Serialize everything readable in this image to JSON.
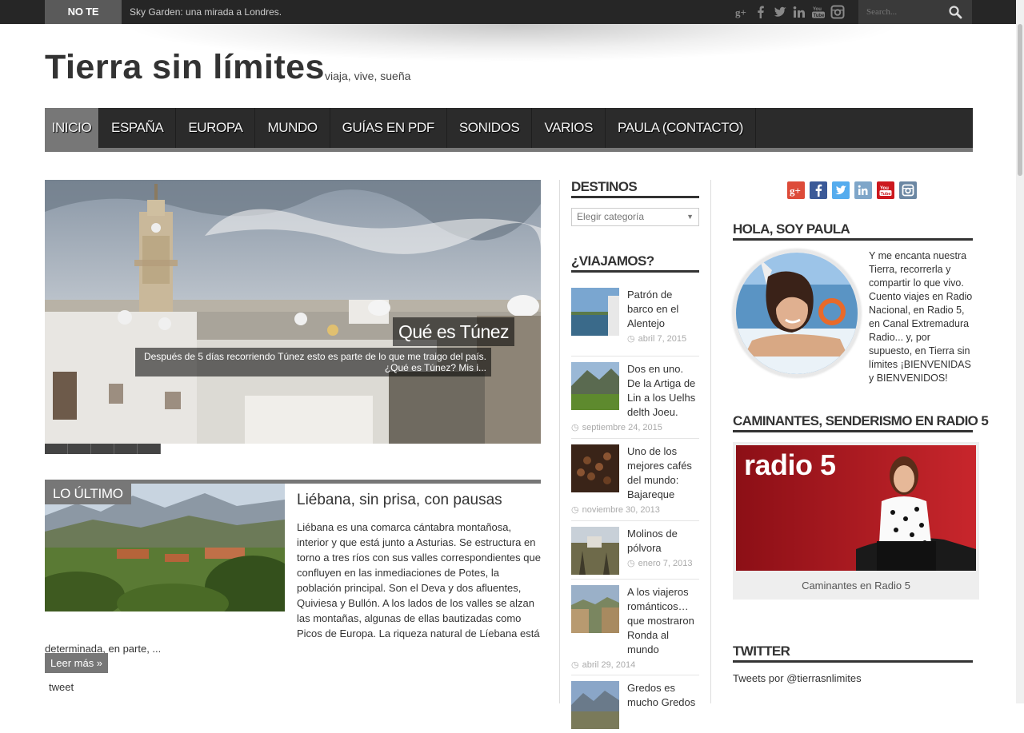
{
  "topbar": {
    "label": "NO TE PIERDAS",
    "ticker": "Sky Garden: una mirada a Londres.",
    "social_icons": [
      "google-plus-icon",
      "facebook-icon",
      "twitter-icon",
      "linkedin-icon",
      "youtube-icon",
      "instagram-icon"
    ],
    "search_placeholder": "Search..."
  },
  "header": {
    "title": "Tierra sin límites",
    "tagline": "viaja, vive, sueña"
  },
  "nav": {
    "items": [
      {
        "label": "INICIO"
      },
      {
        "label": "ESPAÑA"
      },
      {
        "label": "EUROPA"
      },
      {
        "label": "MUNDO"
      },
      {
        "label": "GUÍAS EN PDF"
      },
      {
        "label": "SONIDOS"
      },
      {
        "label": "VARIOS"
      },
      {
        "label": "PAULA (CONTACTO)"
      }
    ]
  },
  "slider": {
    "title": "Qué es Túnez",
    "excerpt": "Después de 5 días recorriendo Túnez esto es parte de lo que me traigo del país. ¿Qué es Túnez? Mis i..."
  },
  "latest": {
    "label": "LO ÚLTIMO",
    "post_title": "Liébana, sin prisa, con pausas",
    "post_body": "Liébana es una comarca cántabra montañosa, interior y que está junto a Asturias. Se estructura en torno a tres ríos con sus valles correspondientes que confluyen en las inmediaciones de Potes, la población principal. Son el Deva y dos afluentes, Quiviesa y Bullón. A los lados de los valles se alzan las montañas, algunas de ellas bautizadas como Picos de Europa. La riqueza natural de Líebana está determinada, en parte, ...",
    "read_more": "Leer más »",
    "tweet": "tweet"
  },
  "sidebar_left": {
    "destinos_title": "DESTINOS",
    "select_value": "Elegir categoría",
    "viajamos_title": "¿VIAJAMOS?",
    "posts": [
      {
        "title": "Patrón de barco en el Alentejo",
        "date": "abril 7, 2015"
      },
      {
        "title": "Dos en uno. De la Artiga de Lin a los Uelhs delth Joeu.",
        "date": "septiembre 24, 2015"
      },
      {
        "title": "Uno de los mejores cafés del mundo: Bajareque",
        "date": "noviembre 30, 2013"
      },
      {
        "title": "Molinos de pólvora",
        "date": "enero 7, 2013"
      },
      {
        "title": "A los viajeros románticos… que mostraron Ronda al mundo",
        "date": "abril 29, 2014"
      },
      {
        "title": "Gredos es mucho Gredos",
        "date": ""
      }
    ]
  },
  "sidebar_right": {
    "social_icons": [
      "google-plus-icon",
      "facebook-icon",
      "twitter-icon",
      "linkedin-icon",
      "youtube-icon",
      "instagram-icon"
    ],
    "hola_title": "HOLA, SOY PAULA",
    "hola_text": "Y me encanta nuestra Tierra, recorrerla y compartir lo que vivo. Cuento viajes en Radio Nacional, en Radio 5, en Canal Extremadura Radio... y, por supuesto, en Tierra sin límites ¡BIENVENIDAS y BIENVENIDOS!",
    "caminantes_title": "CAMINANTES, SENDERISMO EN RADIO 5",
    "radio_logo": "radio 5",
    "radio_caption": "Caminantes en Radio 5",
    "twitter_title": "TWITTER",
    "twitter_text": "Tweets por @tierrasnlimites"
  },
  "colors": {
    "topbar": "#262626",
    "nav": "#2b2b2b",
    "accent_gray": "#777777",
    "radio_red": "#a8141c",
    "google": "#dd4b39",
    "facebook": "#3b5998",
    "twitter": "#55acee",
    "linkedin": "#7fa6c9",
    "youtube": "#cc181e",
    "instagram": "#6b87a3"
  }
}
